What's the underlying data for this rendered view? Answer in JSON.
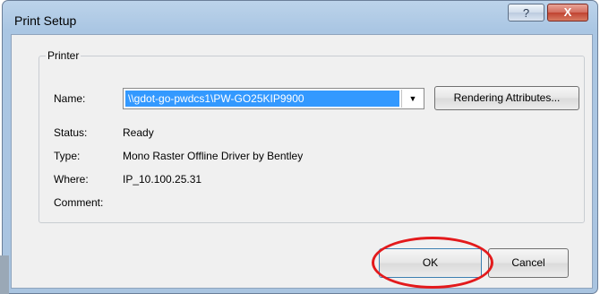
{
  "window": {
    "title": "Print Setup",
    "help_glyph": "?",
    "close_glyph": "X"
  },
  "printer_group": {
    "label": "Printer"
  },
  "fields": {
    "name_label": "Name:",
    "name_value": "\\\\gdot-go-pwdcs1\\PW-GO25KIP9900",
    "status_label": "Status:",
    "status_value": "Ready",
    "type_label": "Type:",
    "type_value": "Mono Raster Offline Driver by Bentley",
    "where_label": "Where:",
    "where_value": "IP_10.100.25.31",
    "comment_label": "Comment:",
    "comment_value": ""
  },
  "buttons": {
    "rendering_attributes": "Rendering Attributes...",
    "ok": "OK",
    "cancel": "Cancel",
    "dropdown_glyph": "▼"
  },
  "icons": {
    "help": "help-icon",
    "close": "close-icon",
    "dropdown": "chevron-down-icon"
  },
  "colors": {
    "selection": "#3399ff",
    "highlight_ring": "#e31a1c"
  }
}
